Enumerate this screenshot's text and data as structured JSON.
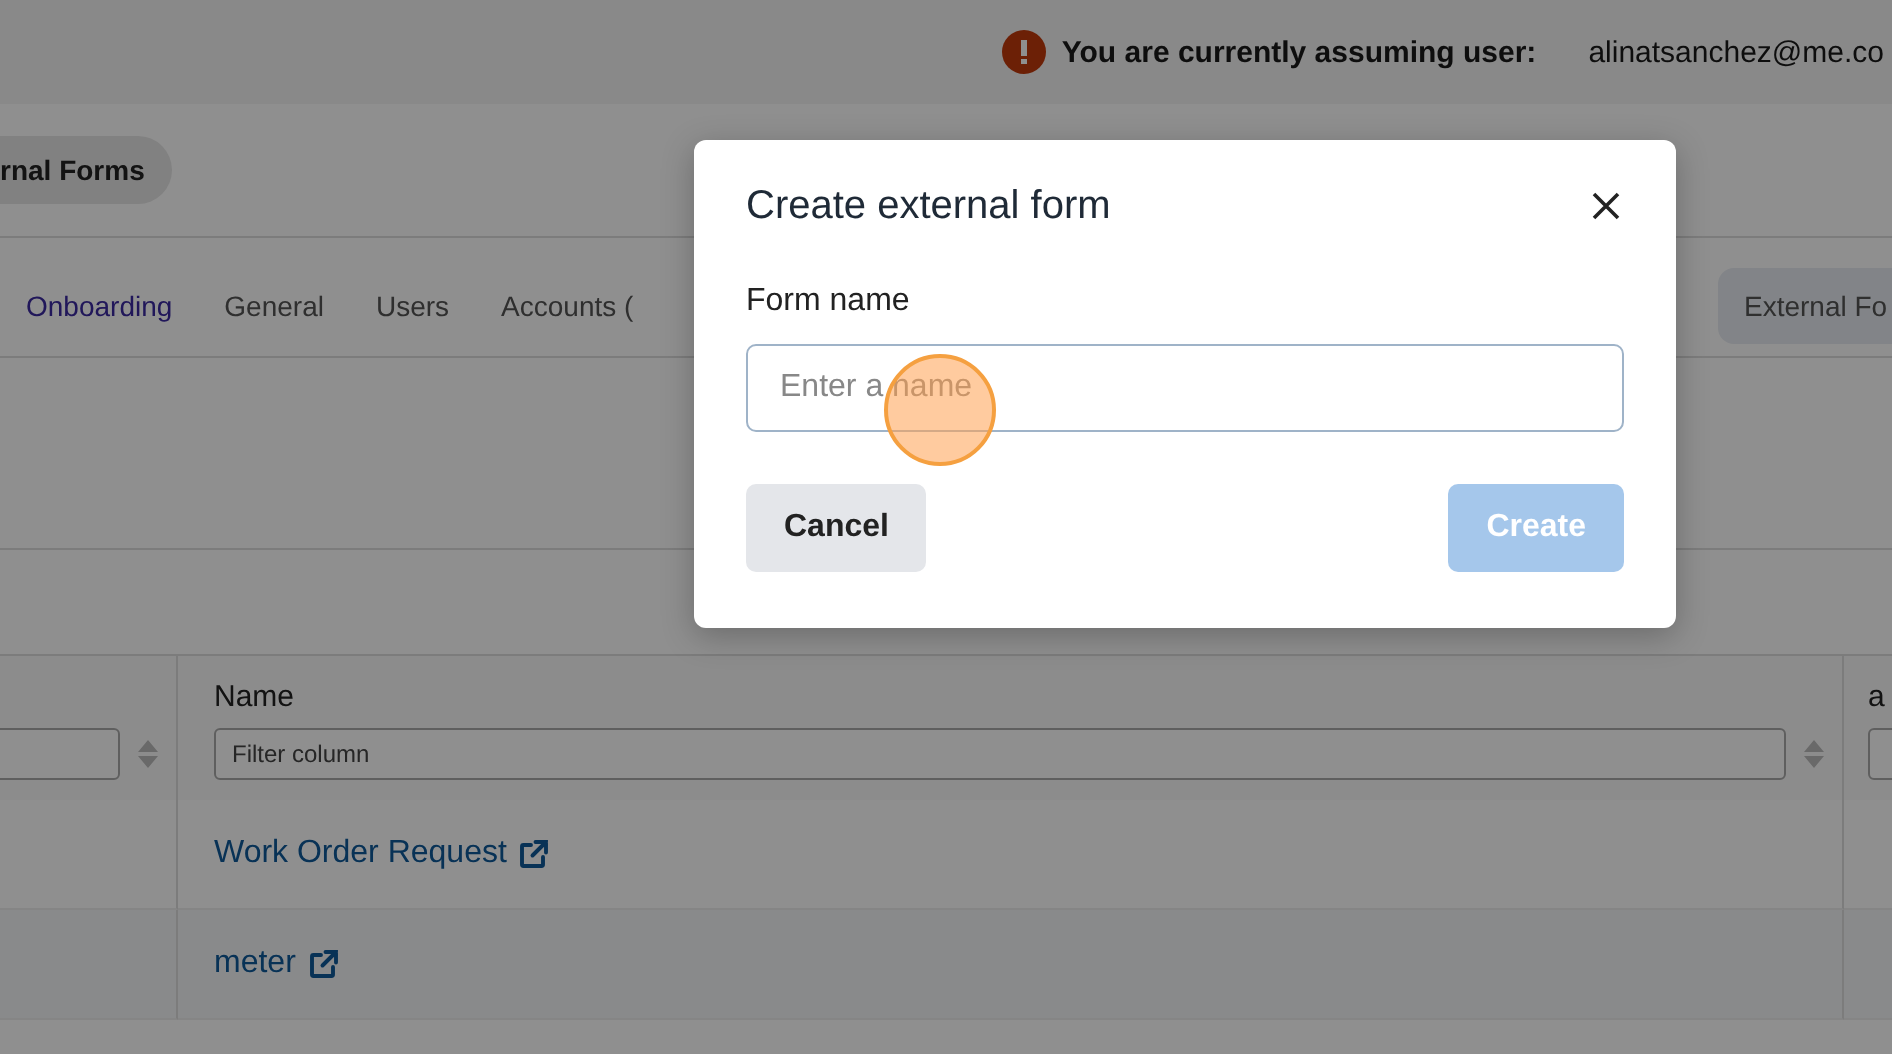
{
  "banner": {
    "message": "You are currently assuming user:",
    "user": "alinatsanchez@me.co"
  },
  "breadcrumb": {
    "label": "rnal Forms"
  },
  "tabs": [
    {
      "label": "Onboarding",
      "kind": "link",
      "selected": false
    },
    {
      "label": "General",
      "kind": "tab",
      "selected": false
    },
    {
      "label": "Users",
      "kind": "tab",
      "selected": false
    },
    {
      "label": "Accounts (",
      "kind": "tab",
      "selected": false
    },
    {
      "label": "External Fo",
      "kind": "tab",
      "selected": true
    }
  ],
  "table": {
    "columns": [
      {},
      {
        "label": "Name",
        "placeholder": "Filter column"
      },
      {
        "label": "a"
      }
    ],
    "rows": [
      {
        "name": "Work Order Request"
      },
      {
        "name": "meter"
      }
    ]
  },
  "modal": {
    "title": "Create external form",
    "field_label": "Form name",
    "placeholder": "Enter a name",
    "buttons": [
      {
        "label": "Cancel",
        "kind": "secondary",
        "disabled": false
      },
      {
        "label": "Create",
        "kind": "primary",
        "disabled": true
      }
    ]
  }
}
